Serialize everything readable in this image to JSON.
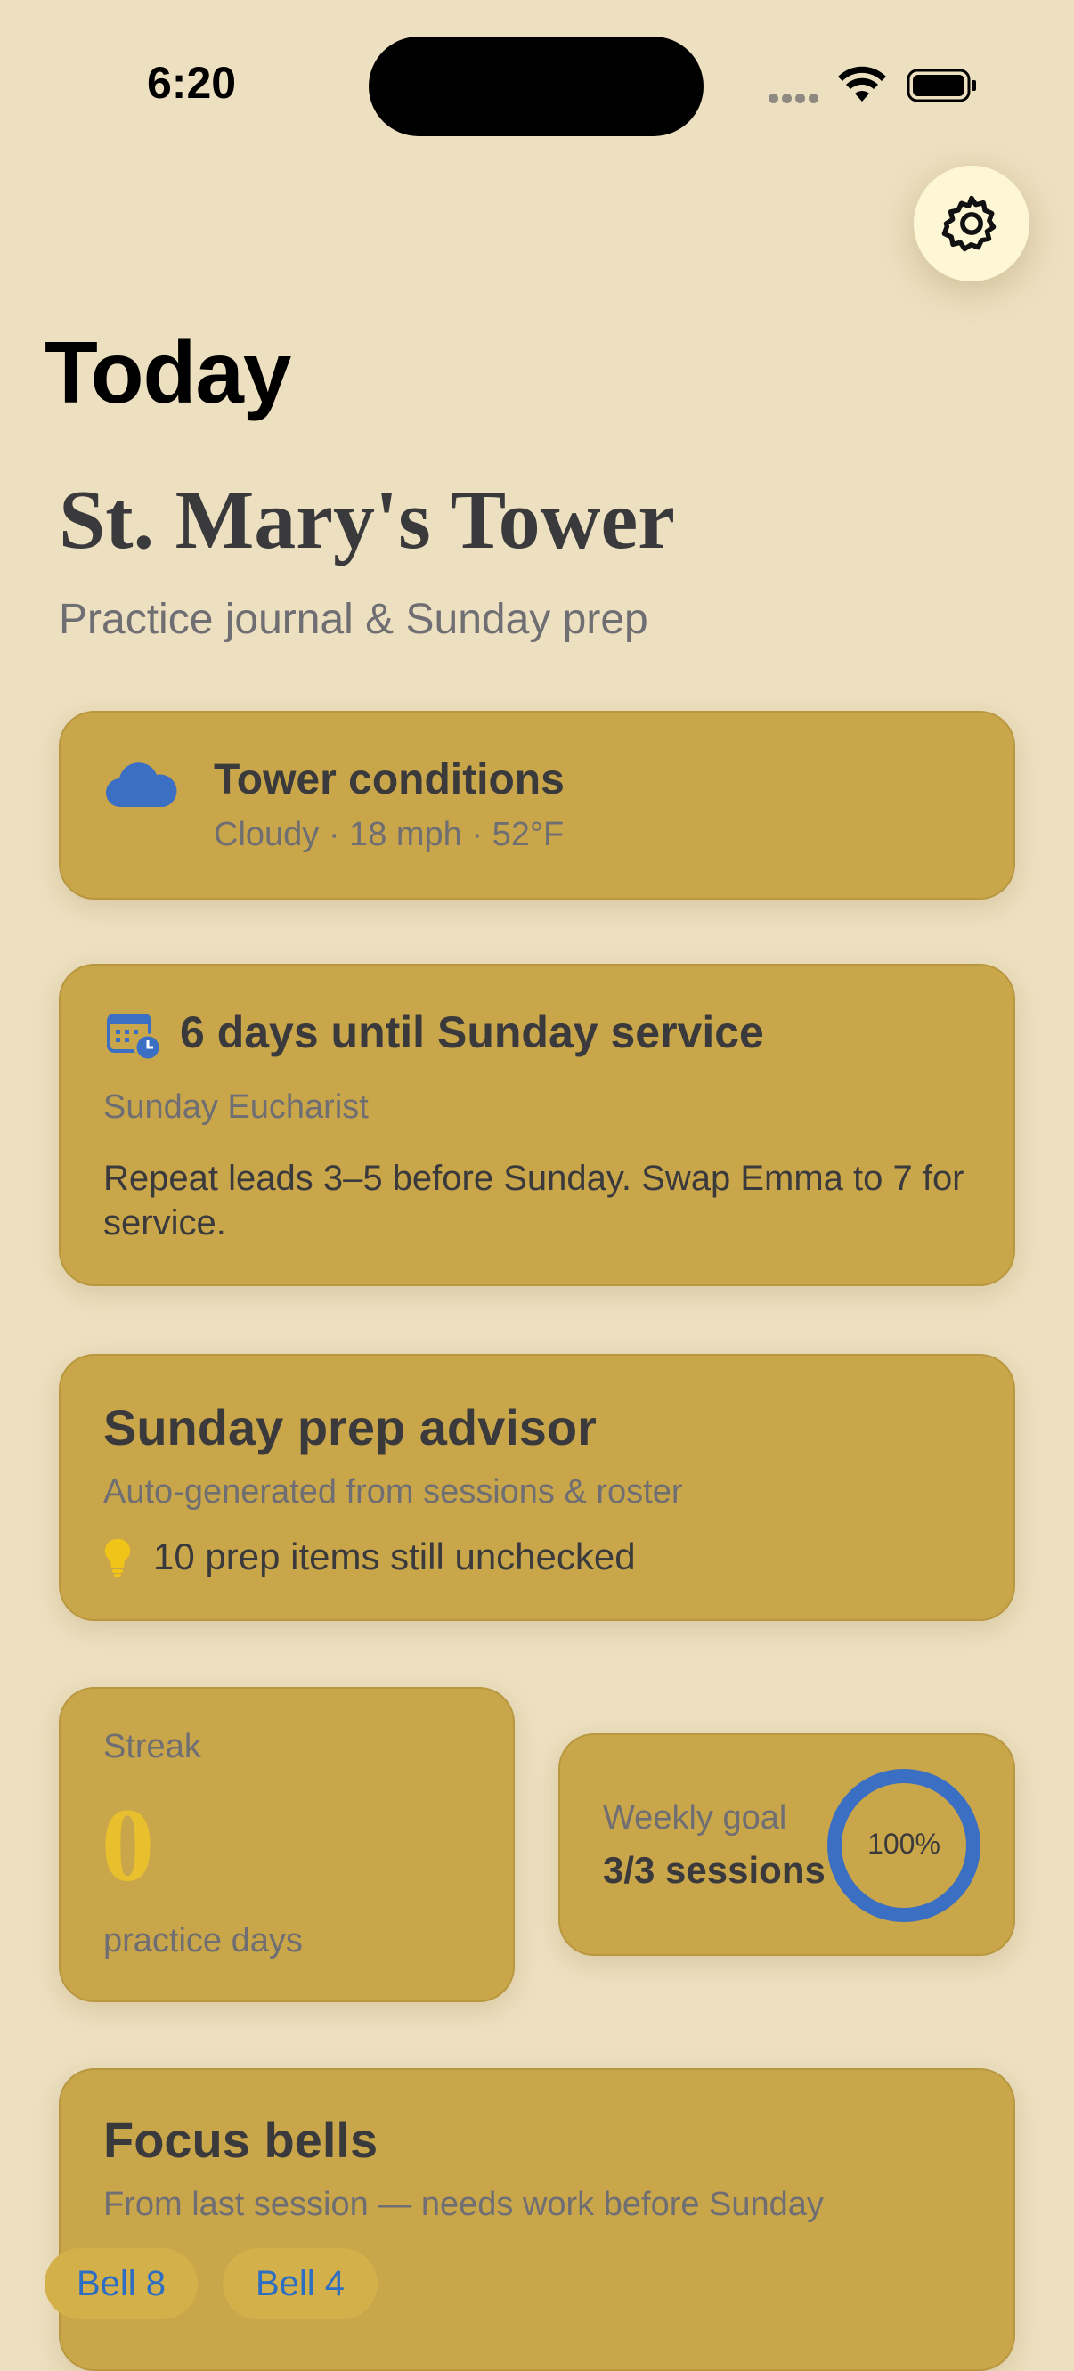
{
  "status_bar": {
    "time": "6:20"
  },
  "header": {
    "nav_title": "Today",
    "tower_name": "St. Mary's Tower",
    "subtitle": "Practice journal & Sunday prep"
  },
  "conditions": {
    "title": "Tower conditions",
    "detail": "Cloudy · 18 mph · 52°F",
    "icon": "cloud-icon"
  },
  "service": {
    "countdown": "6 days until Sunday service",
    "service_name": "Sunday Eucharist",
    "note": "Repeat leads 3–5 before Sunday. Swap Emma to 7 for service.",
    "icon": "calendar-clock-icon"
  },
  "advisor": {
    "title": "Sunday prep advisor",
    "source": "Auto-generated from sessions & roster",
    "tip": "10 prep items still unchecked",
    "icon": "lightbulb-icon"
  },
  "streak": {
    "label": "Streak",
    "value": "0",
    "unit": "practice days"
  },
  "weekly_goal": {
    "label": "Weekly goal",
    "sessions": "3/3 sessions",
    "percent_label": "100%",
    "progress": 1.0
  },
  "focus_bells": {
    "title": "Focus bells",
    "subtitle": "From last session — needs work before Sunday",
    "bells": [
      "Bell 8",
      "Bell 4"
    ]
  },
  "colors": {
    "background": "#ede0c0",
    "card": "#caa64a",
    "accent_blue": "#3a6fc4",
    "streak_gold": "#e8c02e"
  }
}
